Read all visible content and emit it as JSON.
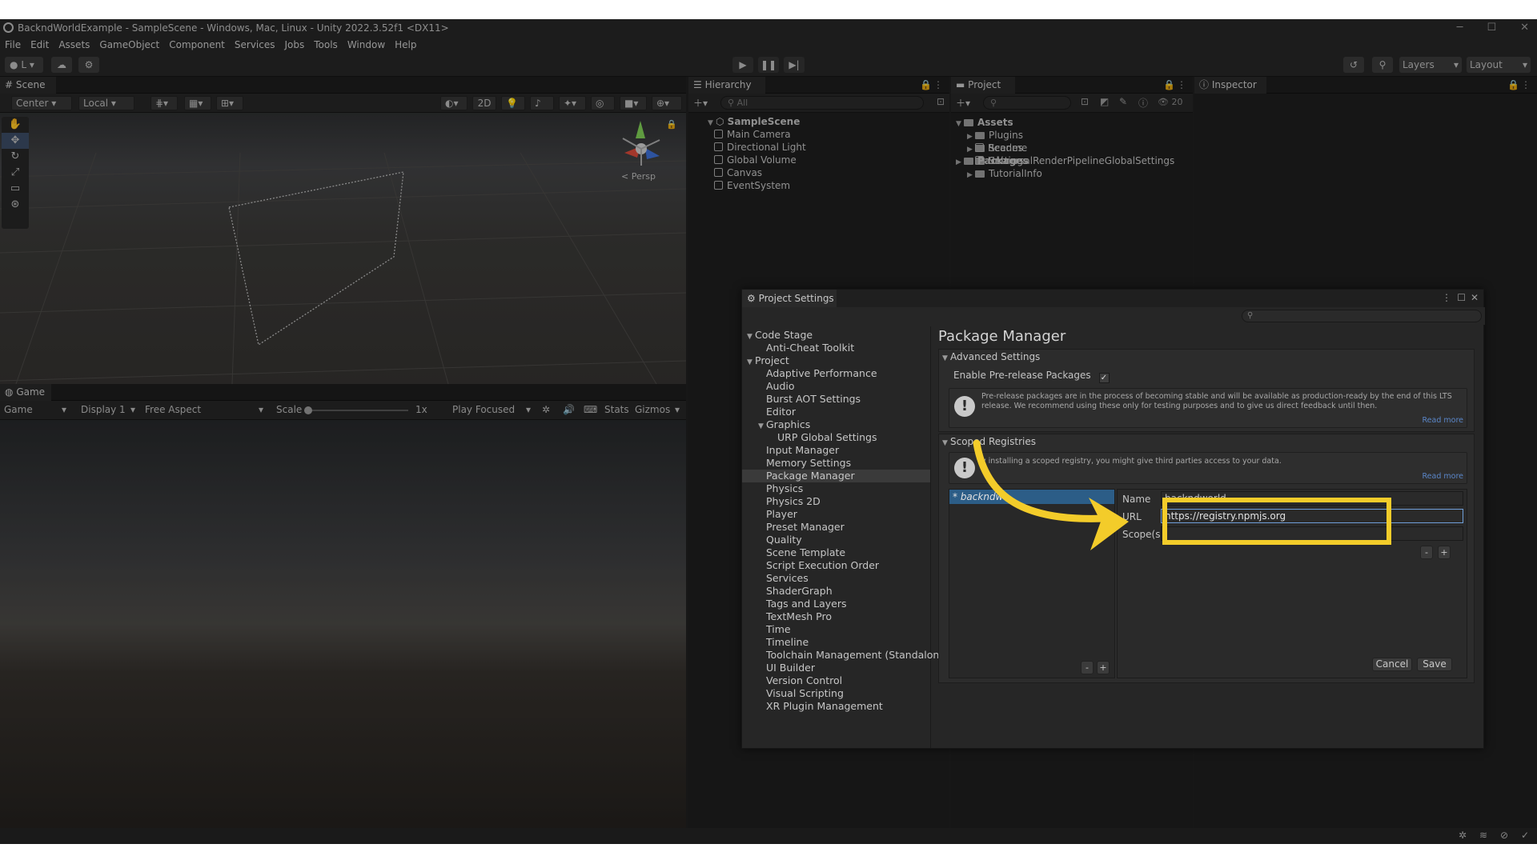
{
  "window": {
    "title": "BackndWorldExample - SampleScene - Windows, Mac, Linux - Unity 2022.3.52f1 <DX11>",
    "minimize": "─",
    "maximize": "☐",
    "close": "✕"
  },
  "menu": [
    "File",
    "Edit",
    "Assets",
    "GameObject",
    "Component",
    "Services",
    "Jobs",
    "Tools",
    "Window",
    "Help"
  ],
  "toolbar": {
    "account": "L",
    "layers": "Layers",
    "layout": "Layout"
  },
  "scene": {
    "tab": "Scene",
    "center": "Center",
    "local": "Local",
    "mode2d": "2D",
    "persp": "< Persp"
  },
  "game": {
    "tab": "Game",
    "game_dropdown": "Game",
    "display": "Display 1",
    "aspect": "Free Aspect",
    "scale_label": "Scale",
    "scale_value": "1x",
    "play_focused": "Play Focused",
    "stats": "Stats",
    "gizmos": "Gizmos"
  },
  "hierarchy": {
    "tab": "Hierarchy",
    "search_placeholder": "All",
    "scene_name": "SampleScene",
    "items": [
      "Main Camera",
      "Directional Light",
      "Global Volume",
      "Canvas",
      "EventSystem"
    ]
  },
  "project": {
    "tab": "Project",
    "count": "20",
    "assets": "Assets",
    "folders": [
      "Plugins",
      "Scenes",
      "Settings",
      "TutorialInfo"
    ],
    "files": [
      "Readme",
      "UniversalRenderPipelineGlobalSettings"
    ],
    "packages": "Packages"
  },
  "inspector": {
    "tab": "Inspector"
  },
  "project_settings": {
    "title": "Project Settings",
    "list": [
      {
        "label": "Code Stage",
        "indent": 0,
        "expand": true
      },
      {
        "label": "Anti-Cheat Toolkit",
        "indent": 1
      },
      {
        "label": "Project",
        "indent": 0,
        "expand": true
      },
      {
        "label": "Adaptive Performance",
        "indent": 1
      },
      {
        "label": "Audio",
        "indent": 1
      },
      {
        "label": "Burst AOT Settings",
        "indent": 1
      },
      {
        "label": "Editor",
        "indent": 1
      },
      {
        "label": "Graphics",
        "indent": 1,
        "expand": true
      },
      {
        "label": "URP Global Settings",
        "indent": 2
      },
      {
        "label": "Input Manager",
        "indent": 1
      },
      {
        "label": "Memory Settings",
        "indent": 1
      },
      {
        "label": "Package Manager",
        "indent": 1,
        "selected": true
      },
      {
        "label": "Physics",
        "indent": 1
      },
      {
        "label": "Physics 2D",
        "indent": 1
      },
      {
        "label": "Player",
        "indent": 1
      },
      {
        "label": "Preset Manager",
        "indent": 1
      },
      {
        "label": "Quality",
        "indent": 1
      },
      {
        "label": "Scene Template",
        "indent": 1
      },
      {
        "label": "Script Execution Order",
        "indent": 1
      },
      {
        "label": "Services",
        "indent": 1
      },
      {
        "label": "ShaderGraph",
        "indent": 1
      },
      {
        "label": "Tags and Layers",
        "indent": 1
      },
      {
        "label": "TextMesh Pro",
        "indent": 1
      },
      {
        "label": "Time",
        "indent": 1
      },
      {
        "label": "Timeline",
        "indent": 1
      },
      {
        "label": "Toolchain Management (Standalone",
        "indent": 1
      },
      {
        "label": "UI Builder",
        "indent": 1
      },
      {
        "label": "Version Control",
        "indent": 1
      },
      {
        "label": "Visual Scripting",
        "indent": 1
      },
      {
        "label": "XR Plugin Management",
        "indent": 1
      }
    ],
    "heading": "Package Manager",
    "advanced": {
      "title": "Advanced Settings",
      "prerelease_label": "Enable Pre-release Packages",
      "checkmark": "✓",
      "info": "Pre-release packages are in the process of becoming stable and will be available as production-ready by the end of this LTS release. We recommend using these only for testing purposes and to give us direct feedback until then.",
      "read_more": "Read more"
    },
    "scoped": {
      "title": "Scoped Registries",
      "info": "y installing a scoped registry, you might give third parties access to your data.",
      "read_more": "Read more",
      "entry": "* backndwo",
      "name_label": "Name",
      "name_value": "backndworld",
      "url_label": "URL",
      "url_value": "https://registry.npmjs.org",
      "scope_label": "Scope(s)",
      "minus": "-",
      "plus": "+",
      "cancel": "Cancel",
      "save": "Save"
    }
  }
}
